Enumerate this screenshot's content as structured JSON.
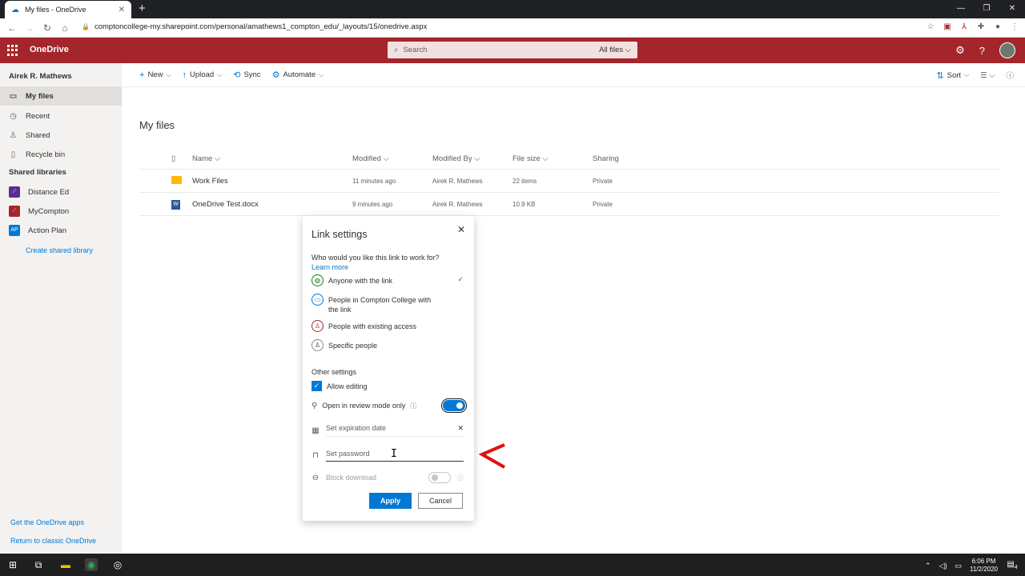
{
  "browser": {
    "tab_title": "My files - OneDrive",
    "url": "comptoncollege-my.sharepoint.com/personal/amathews1_compton_edu/_layouts/15/onedrive.aspx"
  },
  "suite": {
    "app_name": "OneDrive",
    "search_placeholder": "Search",
    "search_scope": "All files"
  },
  "sidebar": {
    "user": "Airek R. Mathews",
    "items": [
      {
        "label": "My files",
        "icon": "folder-icon"
      },
      {
        "label": "Recent",
        "icon": "clock-icon"
      },
      {
        "label": "Shared",
        "icon": "people-icon"
      },
      {
        "label": "Recycle bin",
        "icon": "trash-icon"
      }
    ],
    "shared_libraries_title": "Shared libraries",
    "libraries": [
      {
        "label": "Distance Ed",
        "color": "#5c2d91"
      },
      {
        "label": "MyCompton",
        "color": "#a4262c"
      },
      {
        "label": "Action Plan",
        "color": "#0078d4"
      }
    ],
    "create_library": "Create shared library",
    "get_apps": "Get the OneDrive apps",
    "return_classic": "Return to classic OneDrive"
  },
  "commands": {
    "new": "New",
    "upload": "Upload",
    "sync": "Sync",
    "automate": "Automate",
    "sort": "Sort"
  },
  "page_title": "My files",
  "file_list": {
    "headers": {
      "name": "Name",
      "modified": "Modified",
      "modified_by": "Modified By",
      "file_size": "File size",
      "sharing": "Sharing"
    },
    "rows": [
      {
        "type": "folder",
        "name": "Work Files",
        "modified": "11 minutes ago",
        "modified_by": "Airek R. Mathews",
        "size": "22 items",
        "sharing": "Private"
      },
      {
        "type": "word",
        "name": "OneDrive Test.docx",
        "modified": "9 minutes ago",
        "modified_by": "Airek R. Mathews",
        "size": "10.9 KB",
        "sharing": "Private"
      }
    ]
  },
  "dialog": {
    "title": "Link settings",
    "question": "Who would you like this link to work for?",
    "learn_more": "Learn more",
    "options": [
      {
        "label": "Anyone with the link",
        "selected": true
      },
      {
        "label": "People in Compton College with the link",
        "selected": false
      },
      {
        "label": "People with existing access",
        "selected": false
      },
      {
        "label": "Specific people",
        "selected": false
      }
    ],
    "other_settings": "Other settings",
    "allow_editing": "Allow editing",
    "review_mode": "Open in review mode only",
    "expiration_placeholder": "Set expiration date",
    "password_placeholder": "Set password",
    "block_download": "Block download",
    "apply": "Apply",
    "cancel": "Cancel"
  },
  "taskbar": {
    "time": "6:06 PM",
    "date": "11/2/2020",
    "notification_count": "4"
  }
}
